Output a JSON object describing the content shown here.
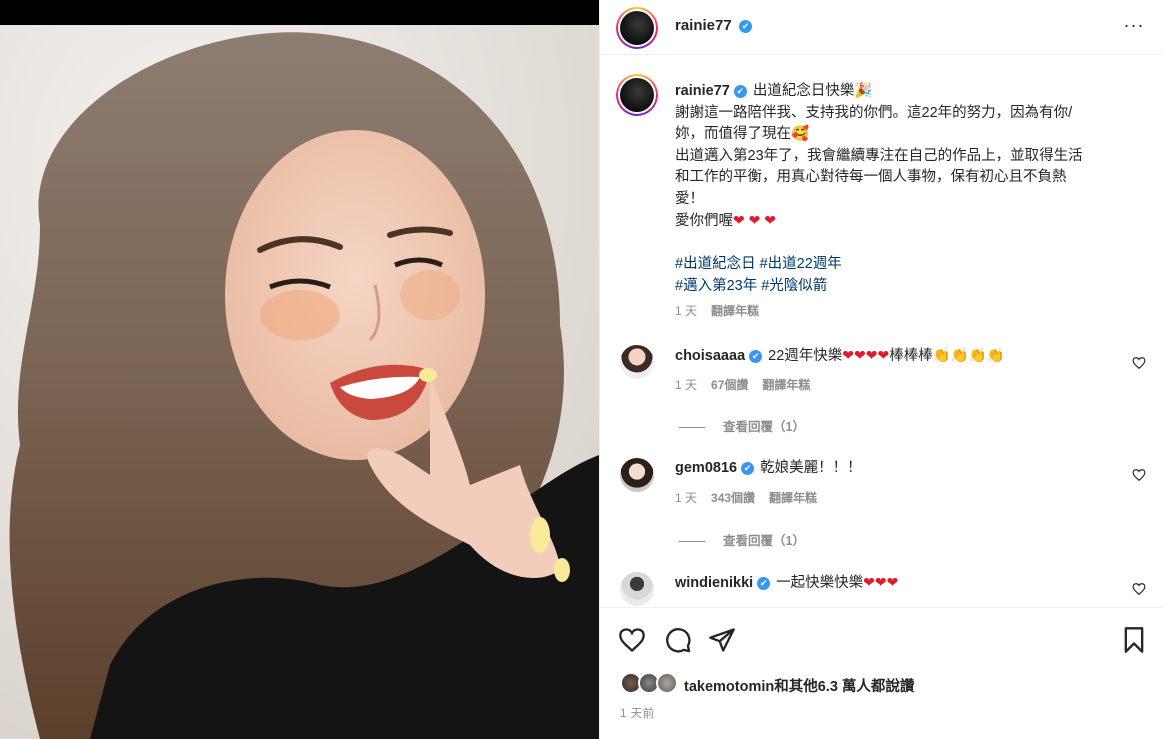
{
  "post": {
    "username": "rainie77",
    "verified_mark": "✔",
    "more_icon": "more-horizontal-icon"
  },
  "caption": {
    "username": "rainie77",
    "lines": [
      "出道紀念日快樂🎉",
      "謝謝這一路陪伴我、支持我的你們。這22年的努力，因為有你/",
      "妳，而值得了現在🥰",
      "出道邁入第23年了，我會繼續專注在自己的作品上，並取得生活",
      "和工作的平衡，用真心對待每一個人事物，保有初心且不負熱",
      "愛！",
      "愛你們喔"
    ],
    "hearts": "❤ ❤ ❤",
    "hashtags_line1": "#出道紀念日 #出道22週年",
    "hashtags_line2": "#邁入第23年 #光陰似箭",
    "time": "1 天",
    "translate": "翻譯年糕"
  },
  "comments": [
    {
      "username": "choisaaaa",
      "text_before": "22週年快樂",
      "hearts": "❤❤❤❤",
      "text_after": "棒棒棒👏👏👏👏",
      "time": "1 天",
      "likes": "67個讚",
      "translate": "翻譯年糕",
      "replies": "查看回覆（1）"
    },
    {
      "username": "gem0816",
      "text_before": "乾娘美麗！！！",
      "hearts": "",
      "text_after": "",
      "time": "1 天",
      "likes": "343個讚",
      "translate": "翻譯年糕",
      "replies": "查看回覆（1）"
    },
    {
      "username": "windienikki",
      "text_before": "一起快樂快樂",
      "hearts": "❤❤❤",
      "text_after": ""
    }
  ],
  "footer": {
    "likes_text": "takemotomin和其他6.3 萬人都說讚",
    "post_time": "1 天前"
  },
  "colors": {
    "link": "#00376b",
    "heart": "#e0192b",
    "verified": "#3897f0",
    "muted": "#8e8e8e"
  }
}
